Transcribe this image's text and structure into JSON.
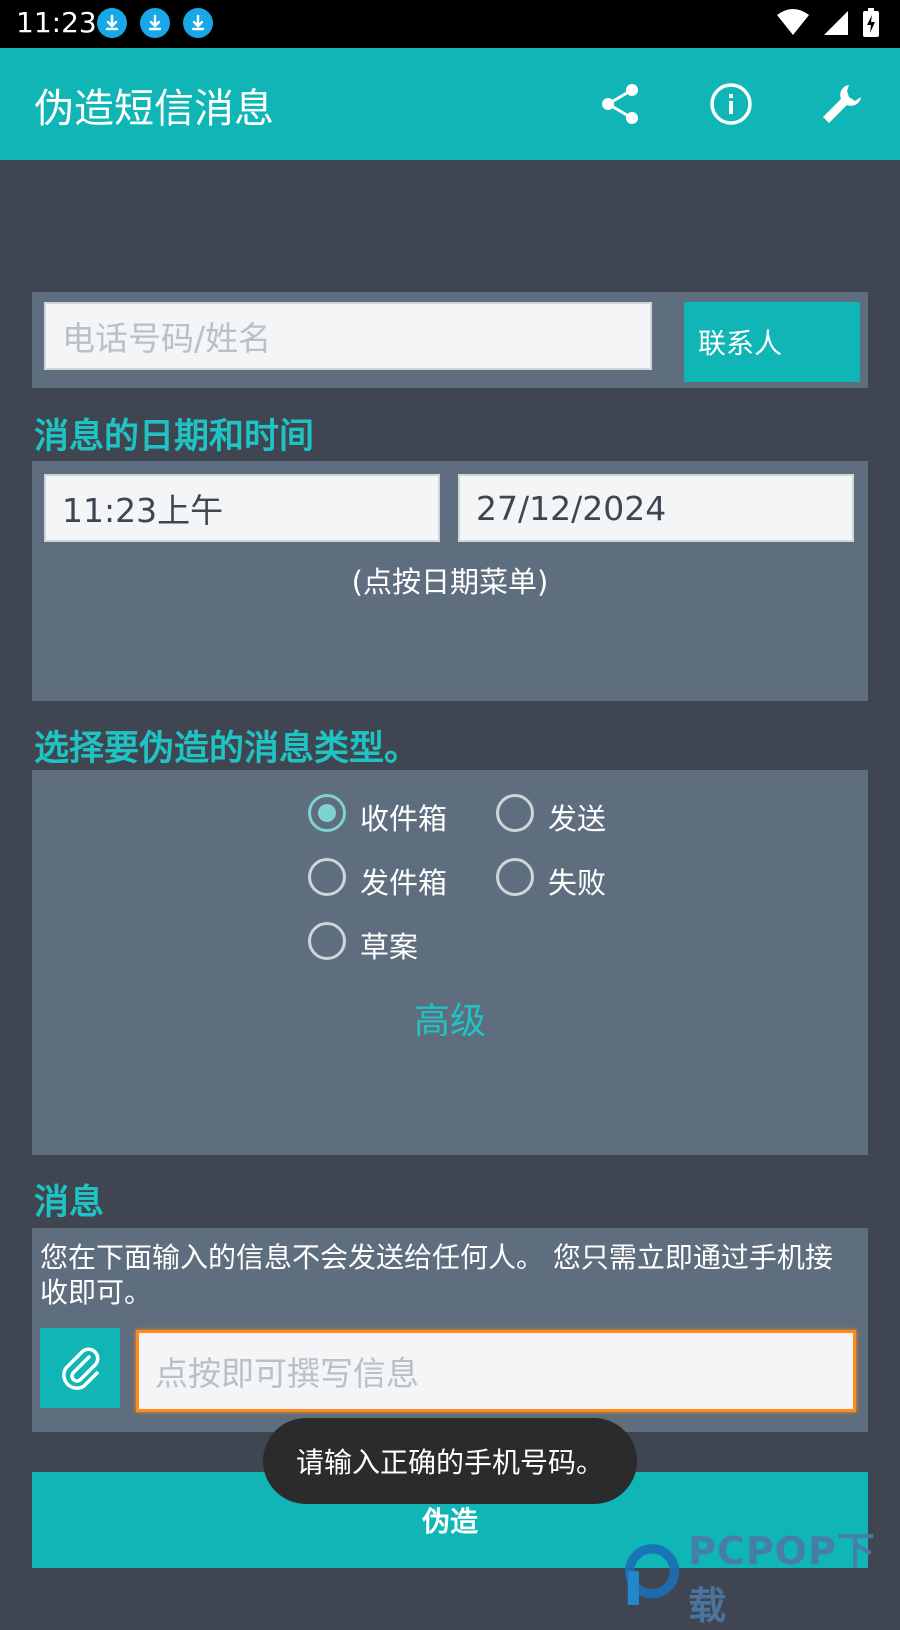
{
  "status_bar": {
    "time": "11:23",
    "download_icons": [
      "download-icon",
      "download-icon",
      "download-icon"
    ],
    "right_icons": [
      "wifi-icon",
      "signal-icon",
      "battery-charging-icon"
    ]
  },
  "app_bar": {
    "title": "伪造短信消息",
    "icons": [
      "share-icon",
      "info-icon",
      "wrench-icon"
    ],
    "color": "#10b5b5"
  },
  "recipient": {
    "placeholder": "电话号码/姓名",
    "contacts_button": "联系人"
  },
  "datetime": {
    "section_label": "消息的日期和时间",
    "time_value": "11:23上午",
    "date_value": "27/12/2024",
    "hint": "(点按日期菜单)"
  },
  "message_type": {
    "section_label": "选择要伪造的消息类型。",
    "options": [
      {
        "label": "收件箱",
        "checked": true
      },
      {
        "label": "发送",
        "checked": false
      },
      {
        "label": "发件箱",
        "checked": false
      },
      {
        "label": "失败",
        "checked": false
      },
      {
        "label": "草案",
        "checked": false
      }
    ],
    "advanced_label": "高级"
  },
  "message": {
    "section_label": "消息",
    "note": "您在下面输入的信息不会发送给任何人。 您只需立即通过手机接收即可。",
    "input_placeholder": "点按即可撰写信息",
    "attach_icon": "paperclip-icon"
  },
  "toast": {
    "text": "请输入正确的手机号码。"
  },
  "fake_button": {
    "label": "伪造"
  },
  "watermark": {
    "text": "PCPOP下载"
  }
}
